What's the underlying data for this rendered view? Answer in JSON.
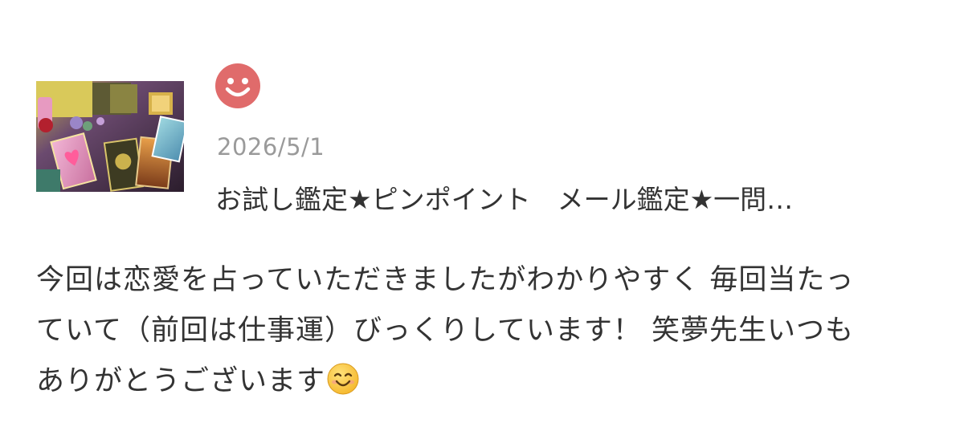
{
  "review": {
    "thumbnail_alt": "tarot-cards-photo",
    "rating_icon": "smile-face-icon",
    "rating_color": "#e06b6b",
    "date": "2026/5/1",
    "title": "お試し鑑定★ピンポイント　メール鑑定★一問…",
    "body_lines": [
      "今回は恋愛を占っていただきましたがわかりやすく 毎回当たっ",
      "ていて（前回は仕事運）びっくりしています！ 笑夢先生いつも",
      "ありがとうございます"
    ],
    "trailing_emoji": "smiling-face-emoji"
  }
}
